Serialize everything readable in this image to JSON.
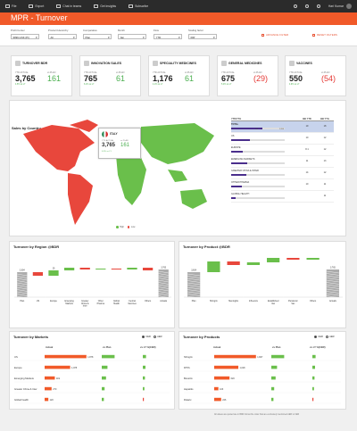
{
  "toolbar": {
    "items": [
      "File",
      "Export",
      "Chat in teams",
      "Get insights",
      "Subscribe"
    ],
    "user": "Hari Kumar"
  },
  "header": {
    "title": "MPR - Turnover"
  },
  "filters": [
    {
      "label": "Profit Center",
      "value": "9999-GSK (Pr)"
    },
    {
      "label": "Product Hierarchy",
      "value": "All"
    },
    {
      "label": "Comparative",
      "value": "Plan"
    },
    {
      "label": "Month",
      "value": "Jan"
    },
    {
      "label": "Flow",
      "value": "YTD"
    },
    {
      "label": "Scaling factor",
      "value": "000'"
    }
  ],
  "filter_buttons": {
    "advance": "ADVANCE FILTER",
    "reset": "RESET FILTERS"
  },
  "kpis": [
    {
      "name": "TURNOVER BDR",
      "actual": "3,765",
      "vs": "161",
      "vs_sign": "pos",
      "note": "4.5% vs LY",
      "actual_label": "YTD ACTUAL",
      "vs_label": "vs PLAN"
    },
    {
      "name": "INNOVATION SALES",
      "actual": "765",
      "vs": "61",
      "vs_sign": "pos",
      "note": "6.1% vs LY",
      "actual_label": "YTD ACTUAL",
      "vs_label": "vs PLAN"
    },
    {
      "name": "SPECIALITY MEDICINES",
      "actual": "1,176",
      "vs": "61",
      "vs_sign": "pos",
      "note": "4.1% vs LY",
      "actual_label": "YTD ACTUAL",
      "vs_label": "vs PLAN"
    },
    {
      "name": "GENERAL MEDICINES",
      "actual": "675",
      "vs": "(29)",
      "vs_sign": "neg",
      "note": "5.4% vs LY",
      "actual_label": "YTD ACTUAL",
      "vs_label": "vs PLAN"
    },
    {
      "name": "VACCINES",
      "actual": "550",
      "vs": "(54)",
      "vs_sign": "neg",
      "note": "4.9% vs LY",
      "actual_label": "YTD ACTUAL",
      "vs_label": "vs PLAN"
    }
  ],
  "colors": {
    "accent": "#f15a29",
    "positive": "#4caf50",
    "negative": "#e53935",
    "bar_purple": "#4a2e8c",
    "bar_gray": "#9e9e9e",
    "map_green": "#6abf4b",
    "map_red": "#e8473c"
  },
  "sales_by_country": {
    "title": "Sales by Country",
    "tooltip": {
      "country": "ITALY",
      "actual_label": "YTD ACTUAL",
      "plan_label": "vs PLAN",
      "actual": "3,765",
      "vs": "161",
      "note": "6.3% vs LY"
    },
    "legend": [
      "High",
      "Low"
    ],
    "table_headers": [
      "YTD/YTG",
      "BB YTD",
      "BB YTG"
    ],
    "rows": [
      {
        "name": "TOTAL",
        "a": "700",
        "b": "1,200",
        "bb_ytd": "19",
        "bb_ytg": "18",
        "sel": true,
        "frac": 0.58
      },
      {
        "name": "US",
        "a": "",
        "b": "",
        "bb_ytd": "10",
        "bb_ytg": "12",
        "frac": 0.35
      },
      {
        "name": "EUROPE",
        "a": "",
        "b": "",
        "bb_ytd": "8.1",
        "bb_ytg": "12",
        "frac": 0.22
      },
      {
        "name": "EMERGING MARKETS",
        "a": "",
        "b": "",
        "bb_ytd": "11",
        "bb_ytg": "13",
        "frac": 0.3
      },
      {
        "name": "GREATER CHINA & INTER",
        "a": "",
        "b": "",
        "bb_ytd": "14",
        "bb_ytg": "12",
        "frac": 0.28
      },
      {
        "name": "OTHER PHARMA",
        "a": "",
        "b": "",
        "bb_ytd": "10",
        "bb_ytg": "11",
        "frac": 0.2
      },
      {
        "name": "GLOBAL HEALTH",
        "a": "",
        "b": "",
        "bb_ytd": "",
        "bb_ytg": "11",
        "frac": 0.08
      }
    ]
  },
  "bridge_region": {
    "title": "Turnover by Region @BDR",
    "labels": [
      "Plan",
      "US",
      "Europe",
      "Emerging Markets",
      "Greater China & Inter",
      "Other Pharma",
      "Global Health",
      "Central Vaccines",
      "Others",
      "Actuals"
    ],
    "values": [
      "3,604",
      "",
      "29",
      "",
      "",
      "",
      "",
      "",
      "",
      "3,765"
    ]
  },
  "bridge_product": {
    "title": "Turnover by Product @BDR",
    "labels": [
      "Plan",
      "Shingrix",
      "Meningitis",
      "Influenza",
      "Established Vac",
      "Pandemic Vac",
      "Others",
      "Actuals"
    ],
    "values": [
      "3,604",
      "",
      "",
      "",
      "",
      "",
      "",
      "3,765"
    ]
  },
  "markets_table": {
    "title": "Turnover by Markets",
    "radio": [
      "CER",
      "AER"
    ],
    "headers": [
      "Actual",
      "vs Plan",
      "vs LY %(CER)"
    ],
    "rows": [
      {
        "name": "US",
        "actual": "1,878",
        "frac": 0.9
      },
      {
        "name": "Europe",
        "actual": "1,078",
        "frac": 0.55
      },
      {
        "name": "Emerging Markets",
        "actual": "419",
        "frac": 0.22
      },
      {
        "name": "Greater China & Inter",
        "actual": "270",
        "frac": 0.15
      },
      {
        "name": "Global health",
        "actual": "120",
        "frac": 0.08
      }
    ]
  },
  "products_table": {
    "title": "Turnover by Products",
    "radio": [
      "CER",
      "AER"
    ],
    "headers": [
      "Actual",
      "vs Plan",
      "vs LY %(CER)"
    ],
    "rows": [
      {
        "name": "Shingrix",
        "actual": "1,827",
        "frac": 0.9
      },
      {
        "name": "DTPs",
        "actual": "1,018",
        "frac": 0.52
      },
      {
        "name": "Boostrix",
        "actual": "620",
        "frac": 0.33
      },
      {
        "name": "Hepatitis",
        "actual": "103",
        "frac": 0.09
      },
      {
        "name": "Rotarix",
        "actual": "226",
        "frac": 0.15
      }
    ]
  },
  "footnote": "All values are quoted are in BDR format the order that are exclusively mentioned AER to CER"
}
